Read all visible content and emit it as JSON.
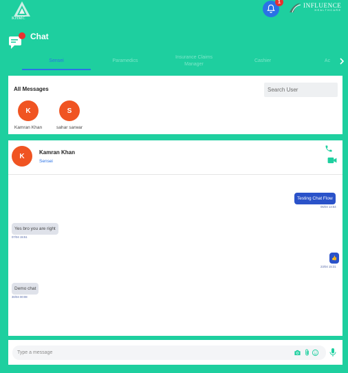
{
  "header": {
    "logo_text": "KHMC",
    "notification_count": "1",
    "brand_name": "INFLUENCE",
    "brand_sub": "HEALTHCARE",
    "colors": {
      "background": "#1ecf9f",
      "accent": "#2a72e6",
      "alert": "#e8302f",
      "avatar": "#f05422"
    }
  },
  "page": {
    "title": "Chat"
  },
  "tabs": [
    {
      "label": "Sensei",
      "active": true
    },
    {
      "label": "Paramedics",
      "active": false
    },
    {
      "label": "Insurance Claims Manager",
      "active": false
    },
    {
      "label": "Cashier",
      "active": false
    },
    {
      "label": "Ac",
      "active": false
    }
  ],
  "messages_panel": {
    "title": "All Messages",
    "search_placeholder": "Search User",
    "contacts": [
      {
        "initial": "K",
        "name": "Kamran Khan"
      },
      {
        "initial": "S",
        "name": "sahar sarwar"
      }
    ]
  },
  "conversation": {
    "contact_initial": "K",
    "contact_name": "Kamran Khan",
    "contact_role": "Sensei",
    "messages": [
      {
        "text": "Testing Chat Flow",
        "time": "05/04 14:54",
        "direction": "out"
      },
      {
        "text": "Yes bro you are right",
        "time": "07/04 15:51",
        "direction": "in"
      },
      {
        "text": "👍",
        "time": "23/04 15:31",
        "direction": "out"
      },
      {
        "text": "Demo chat",
        "time": "30/04 00:08",
        "direction": "in"
      }
    ]
  },
  "composer": {
    "placeholder": "Type a message"
  },
  "icons": [
    "bell-icon",
    "chat-icon",
    "chevron-right-icon",
    "phone-icon",
    "video-icon",
    "camera-icon",
    "attachment-icon",
    "emoji-icon",
    "microphone-icon"
  ]
}
